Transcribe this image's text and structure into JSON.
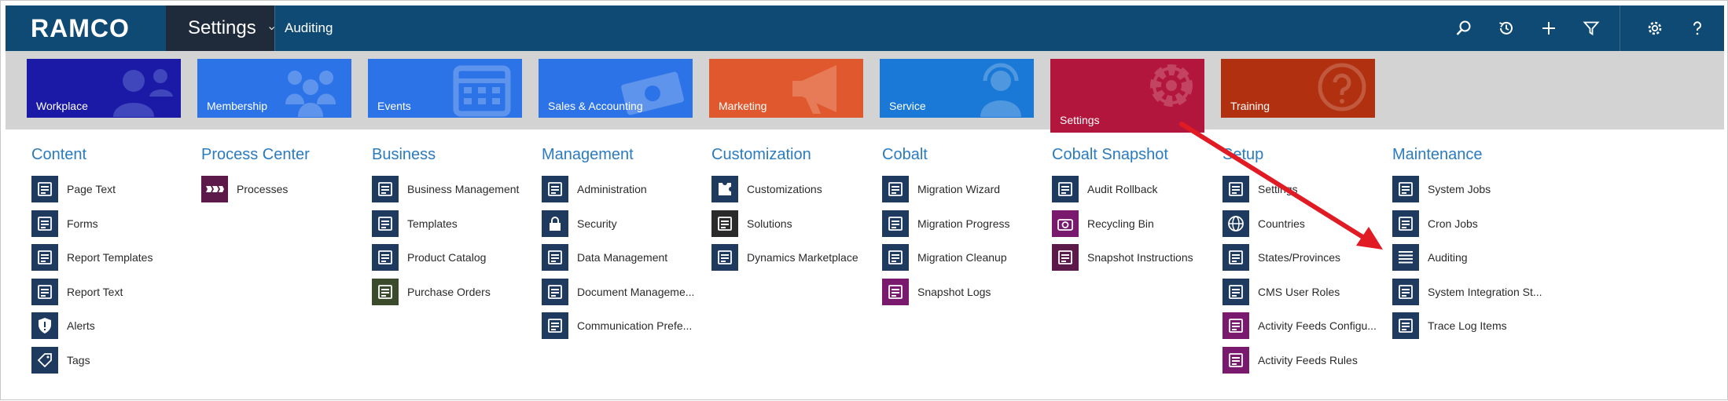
{
  "app": {
    "logo_text": "RAMCO",
    "module_label": "Settings",
    "breadcrumb": "Auditing"
  },
  "toolbar": {
    "icons": [
      "search-icon",
      "history-icon",
      "plus-icon",
      "filter-icon",
      "gear-icon",
      "help-icon"
    ]
  },
  "tiles": [
    {
      "label": "Workplace",
      "color": "#1a1aa6",
      "icon": "users-icon"
    },
    {
      "label": "Membership",
      "color": "#2d73e8",
      "icon": "group-icon"
    },
    {
      "label": "Events",
      "color": "#2d73e8",
      "icon": "calendar-icon"
    },
    {
      "label": "Sales & Accounting",
      "color": "#2d73e8",
      "icon": "money-icon"
    },
    {
      "label": "Marketing",
      "color": "#e0582d",
      "icon": "megaphone-icon"
    },
    {
      "label": "Service",
      "color": "#1a78d6",
      "icon": "headset-icon"
    },
    {
      "label": "Settings",
      "color": "#b3163c",
      "icon": "gear-icon"
    },
    {
      "label": "Training",
      "color": "#b0300f",
      "icon": "question-icon"
    }
  ],
  "columns": [
    {
      "title": "Content",
      "items": [
        "Page Text",
        "Forms",
        "Report Templates",
        "Report Text",
        "Alerts",
        "Tags"
      ]
    },
    {
      "title": "Process Center",
      "items": [
        "Processes"
      ]
    },
    {
      "title": "Business",
      "items": [
        "Business Management",
        "Templates",
        "Product Catalog",
        "Purchase Orders"
      ]
    },
    {
      "title": "Management",
      "items": [
        "Administration",
        "Security",
        "Data Management",
        "Document Manageme...",
        "Communication Prefe..."
      ]
    },
    {
      "title": "Customization",
      "items": [
        "Customizations",
        "Solutions",
        "Dynamics Marketplace"
      ]
    },
    {
      "title": "Cobalt",
      "items": [
        "Migration Wizard",
        "Migration Progress",
        "Migration Cleanup",
        "Snapshot Logs"
      ]
    },
    {
      "title": "Cobalt Snapshot",
      "items": [
        "Audit Rollback",
        "Recycling Bin",
        "Snapshot Instructions"
      ]
    },
    {
      "title": "Setup",
      "items": [
        "Settings",
        "Countries",
        "States/Provinces",
        "CMS User Roles",
        "Activity Feeds Configu...",
        "Activity Feeds Rules"
      ]
    },
    {
      "title": "Maintenance",
      "items": [
        "System Jobs",
        "Cron Jobs",
        "Auditing",
        "System Integration St...",
        "Trace Log Items"
      ]
    }
  ],
  "colors": {
    "topbar": "#0e4a74",
    "heading": "#2b7bbf",
    "annotation_arrow": "#e01b24"
  }
}
